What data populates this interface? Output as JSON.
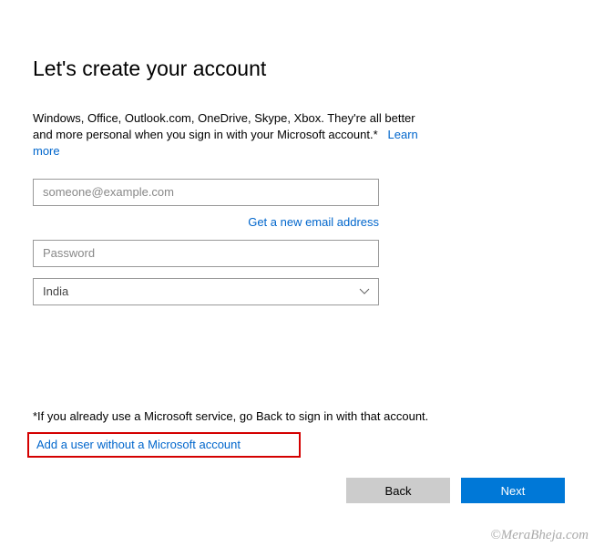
{
  "title": "Let's create your account",
  "description": {
    "text": "Windows, Office, Outlook.com, OneDrive, Skype, Xbox. They're all better and more personal when you sign in with your Microsoft account.*",
    "learn_more": "Learn more"
  },
  "form": {
    "email_placeholder": "someone@example.com",
    "new_email_link": "Get a new email address",
    "password_placeholder": "Password",
    "country_value": "India"
  },
  "note": "*If you already use a Microsoft service, go Back to sign in with that account.",
  "add_user_link": "Add a user without a Microsoft account",
  "buttons": {
    "back": "Back",
    "next": "Next"
  },
  "watermark": "©MeraBheja.com"
}
